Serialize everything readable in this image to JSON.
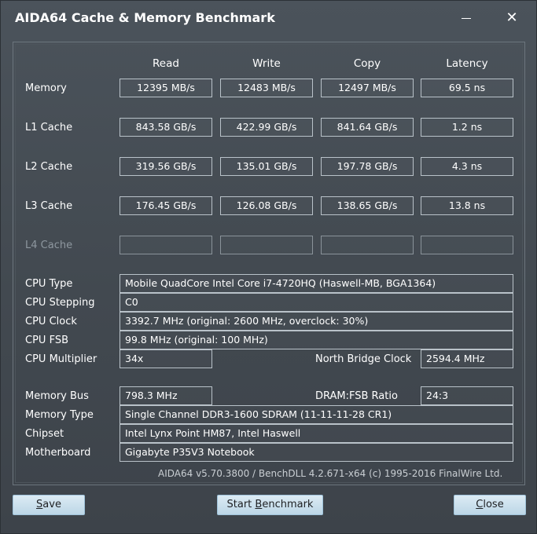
{
  "window": {
    "title": "AIDA64 Cache & Memory Benchmark",
    "close_glyph": "✕"
  },
  "columns": [
    "Read",
    "Write",
    "Copy",
    "Latency"
  ],
  "bench_rows": [
    {
      "label": "Memory",
      "read": "12395 MB/s",
      "write": "12483 MB/s",
      "copy": "12497 MB/s",
      "latency": "69.5 ns"
    },
    {
      "label": "L1 Cache",
      "read": "843.58 GB/s",
      "write": "422.99 GB/s",
      "copy": "841.64 GB/s",
      "latency": "1.2 ns"
    },
    {
      "label": "L2 Cache",
      "read": "319.56 GB/s",
      "write": "135.01 GB/s",
      "copy": "197.78 GB/s",
      "latency": "4.3 ns"
    },
    {
      "label": "L3 Cache",
      "read": "176.45 GB/s",
      "write": "126.08 GB/s",
      "copy": "138.65 GB/s",
      "latency": "13.8 ns"
    },
    {
      "label": "L4 Cache",
      "read": "",
      "write": "",
      "copy": "",
      "latency": ""
    }
  ],
  "cpu": {
    "type_label": "CPU Type",
    "type_value": "Mobile QuadCore Intel Core i7-4720HQ  (Haswell-MB, BGA1364)",
    "stepping_label": "CPU Stepping",
    "stepping_value": "C0",
    "clock_label": "CPU Clock",
    "clock_value": "3392.7 MHz  (original: 2600 MHz, overclock: 30%)",
    "fsb_label": "CPU FSB",
    "fsb_value": "99.8 MHz  (original: 100 MHz)",
    "multiplier_label": "CPU Multiplier",
    "multiplier_value": "34x",
    "nb_clock_label": "North Bridge Clock",
    "nb_clock_value": "2594.4 MHz"
  },
  "memory": {
    "bus_label": "Memory Bus",
    "bus_value": "798.3 MHz",
    "ratio_label": "DRAM:FSB Ratio",
    "ratio_value": "24:3",
    "type_label": "Memory Type",
    "type_value": "Single Channel DDR3-1600 SDRAM  (11-11-11-28 CR1)",
    "chipset_label": "Chipset",
    "chipset_value": "Intel Lynx Point HM87, Intel Haswell",
    "motherboard_label": "Motherboard",
    "motherboard_value": "Gigabyte P35V3 Notebook"
  },
  "footer": "AIDA64 v5.70.3800 / BenchDLL 4.2.671-x64  (c) 1995-2016 FinalWire Ltd.",
  "buttons": {
    "save_pre": "",
    "save_u": "S",
    "save_post": "ave",
    "start_pre": "Start ",
    "start_u": "B",
    "start_post": "enchmark",
    "close_pre": "",
    "close_u": "C",
    "close_post": "lose"
  }
}
